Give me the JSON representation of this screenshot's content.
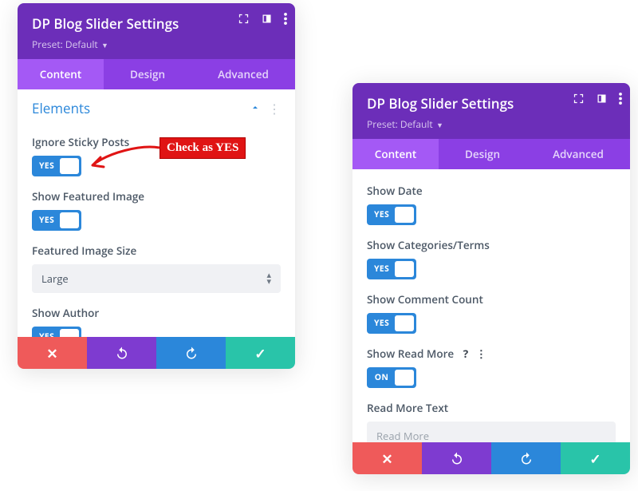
{
  "left": {
    "header": {
      "title": "DP Blog Slider Settings",
      "preset": "Preset: Default"
    },
    "tabs": {
      "content": "Content",
      "design": "Design",
      "advanced": "Advanced",
      "active": "content"
    },
    "section": {
      "title": "Elements"
    },
    "options": {
      "ignore_sticky": {
        "label": "Ignore Sticky Posts",
        "toggle": "YES"
      },
      "featured_image": {
        "label": "Show Featured Image",
        "toggle": "YES"
      },
      "featured_size": {
        "label": "Featured Image Size",
        "value": "Large"
      },
      "show_author": {
        "label": "Show Author",
        "toggle": "YES"
      }
    }
  },
  "right": {
    "header": {
      "title": "DP Blog Slider Settings",
      "preset": "Preset: Default"
    },
    "tabs": {
      "content": "Content",
      "design": "Design",
      "advanced": "Advanced",
      "active": "content"
    },
    "options": {
      "show_date": {
        "label": "Show Date",
        "toggle": "YES"
      },
      "show_cats": {
        "label": "Show Categories/Terms",
        "toggle": "YES"
      },
      "show_comments": {
        "label": "Show Comment Count",
        "toggle": "YES"
      },
      "show_readmore": {
        "label": "Show Read More",
        "toggle": "ON"
      },
      "readmore_text": {
        "label": "Read More Text",
        "placeholder": "Read More"
      }
    }
  },
  "callout": {
    "text": "Check as YES"
  }
}
